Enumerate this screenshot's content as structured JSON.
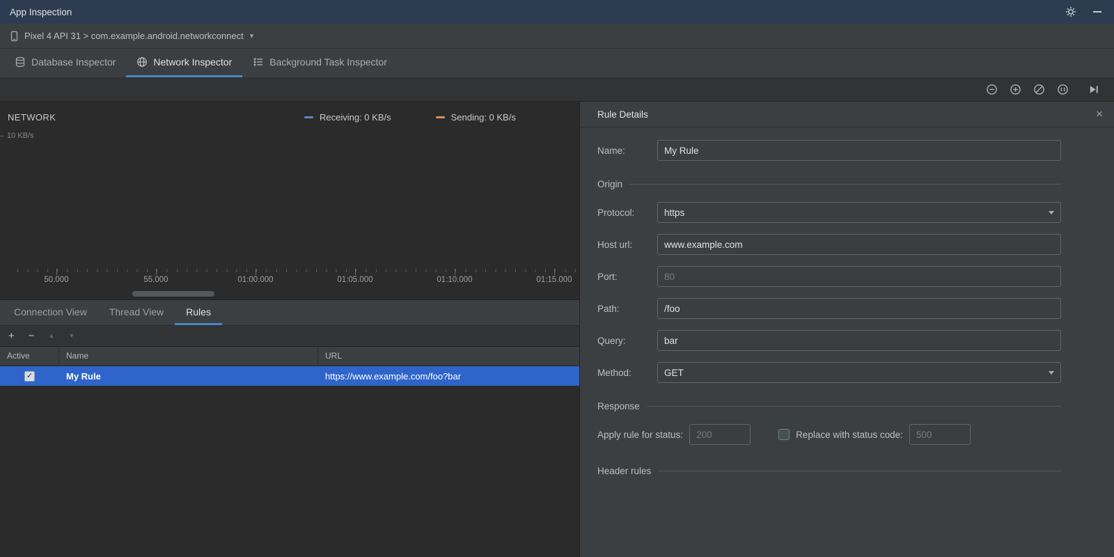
{
  "titlebar": {
    "title": "App Inspection"
  },
  "device_bar": {
    "selection": "Pixel 4 API 31 > com.example.android.networkconnect"
  },
  "inspector_tabs": {
    "items": [
      {
        "label": "Database Inspector",
        "selected": false
      },
      {
        "label": "Network Inspector",
        "selected": true
      },
      {
        "label": "Background Task Inspector",
        "selected": false
      }
    ]
  },
  "chart": {
    "title": "NETWORK",
    "y_label": "10 KB/s",
    "legend": [
      {
        "label": "Receiving: 0 KB/s",
        "color": "#6187C6"
      },
      {
        "label": "Sending: 0 KB/s",
        "color": "#D9915C"
      }
    ],
    "ticks": [
      "50.000",
      "55.000",
      "01:00.000",
      "01:05.000",
      "01:10.000",
      "01:15.000"
    ]
  },
  "view_tabs": {
    "items": [
      {
        "label": "Connection View",
        "selected": false
      },
      {
        "label": "Thread View",
        "selected": false
      },
      {
        "label": "Rules",
        "selected": true
      }
    ]
  },
  "rules_table": {
    "columns": [
      "Active",
      "Name",
      "URL"
    ],
    "rows": [
      {
        "active": true,
        "name": "My Rule",
        "url": "https://www.example.com/foo?bar",
        "selected": true
      }
    ]
  },
  "rule_details": {
    "title": "Rule Details",
    "name": {
      "label": "Name:",
      "value": "My Rule"
    },
    "origin_section": "Origin",
    "protocol": {
      "label": "Protocol:",
      "value": "https"
    },
    "host": {
      "label": "Host url:",
      "value": "www.example.com"
    },
    "port": {
      "label": "Port:",
      "placeholder": "80"
    },
    "path": {
      "label": "Path:",
      "value": "/foo"
    },
    "query": {
      "label": "Query:",
      "value": "bar"
    },
    "method": {
      "label": "Method:",
      "value": "GET"
    },
    "response_section": "Response",
    "status": {
      "label": "Apply rule for status:",
      "placeholder": "200"
    },
    "replace": {
      "label": "Replace with status code:",
      "placeholder": "500",
      "checked": false
    },
    "header_section": "Header rules"
  },
  "icons": {
    "chevron_down": "▾",
    "close": "×",
    "add": "+",
    "remove": "−",
    "move_up": "▲",
    "move_down": "▼",
    "check": "✓"
  },
  "colors": {
    "accent": "#4A88C7",
    "selection_blue": "#2F65CA",
    "receiving": "#6187C6",
    "sending": "#D9915C"
  }
}
